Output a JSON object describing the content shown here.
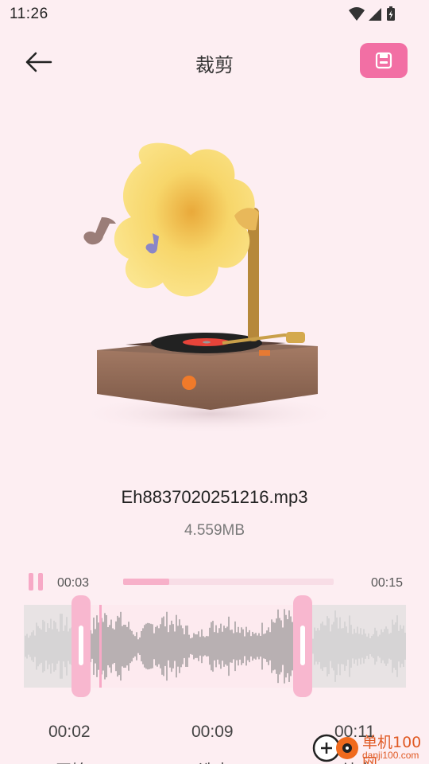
{
  "status_bar": {
    "time": "11:26",
    "icons": [
      "wifi-icon",
      "signal-icon",
      "battery-charging-icon"
    ]
  },
  "app_bar": {
    "back_icon": "arrow-left-icon",
    "title": "裁剪",
    "save_icon": "save-icon",
    "accent": "#f26fa4"
  },
  "file": {
    "name": "Eh8837020251216.mp3",
    "size": "4.559MB"
  },
  "player": {
    "state_icon": "pause-icon",
    "current_time": "00:03",
    "total_time": "00:15",
    "progress": 0.22
  },
  "trim": {
    "start_label": "00:02",
    "mid_label": "00:09",
    "end_label": "00:11",
    "start_fraction": 0.15,
    "end_fraction": 0.73,
    "playhead_fraction": 0.2,
    "bottom_labels": [
      "开始",
      "选中",
      "结束"
    ]
  },
  "colors": {
    "background": "#fdeef2",
    "handle": "#f8b7cf",
    "wave": "#8a8a8a"
  },
  "watermark": {
    "name": "单机100网",
    "url": "danji100.com"
  }
}
